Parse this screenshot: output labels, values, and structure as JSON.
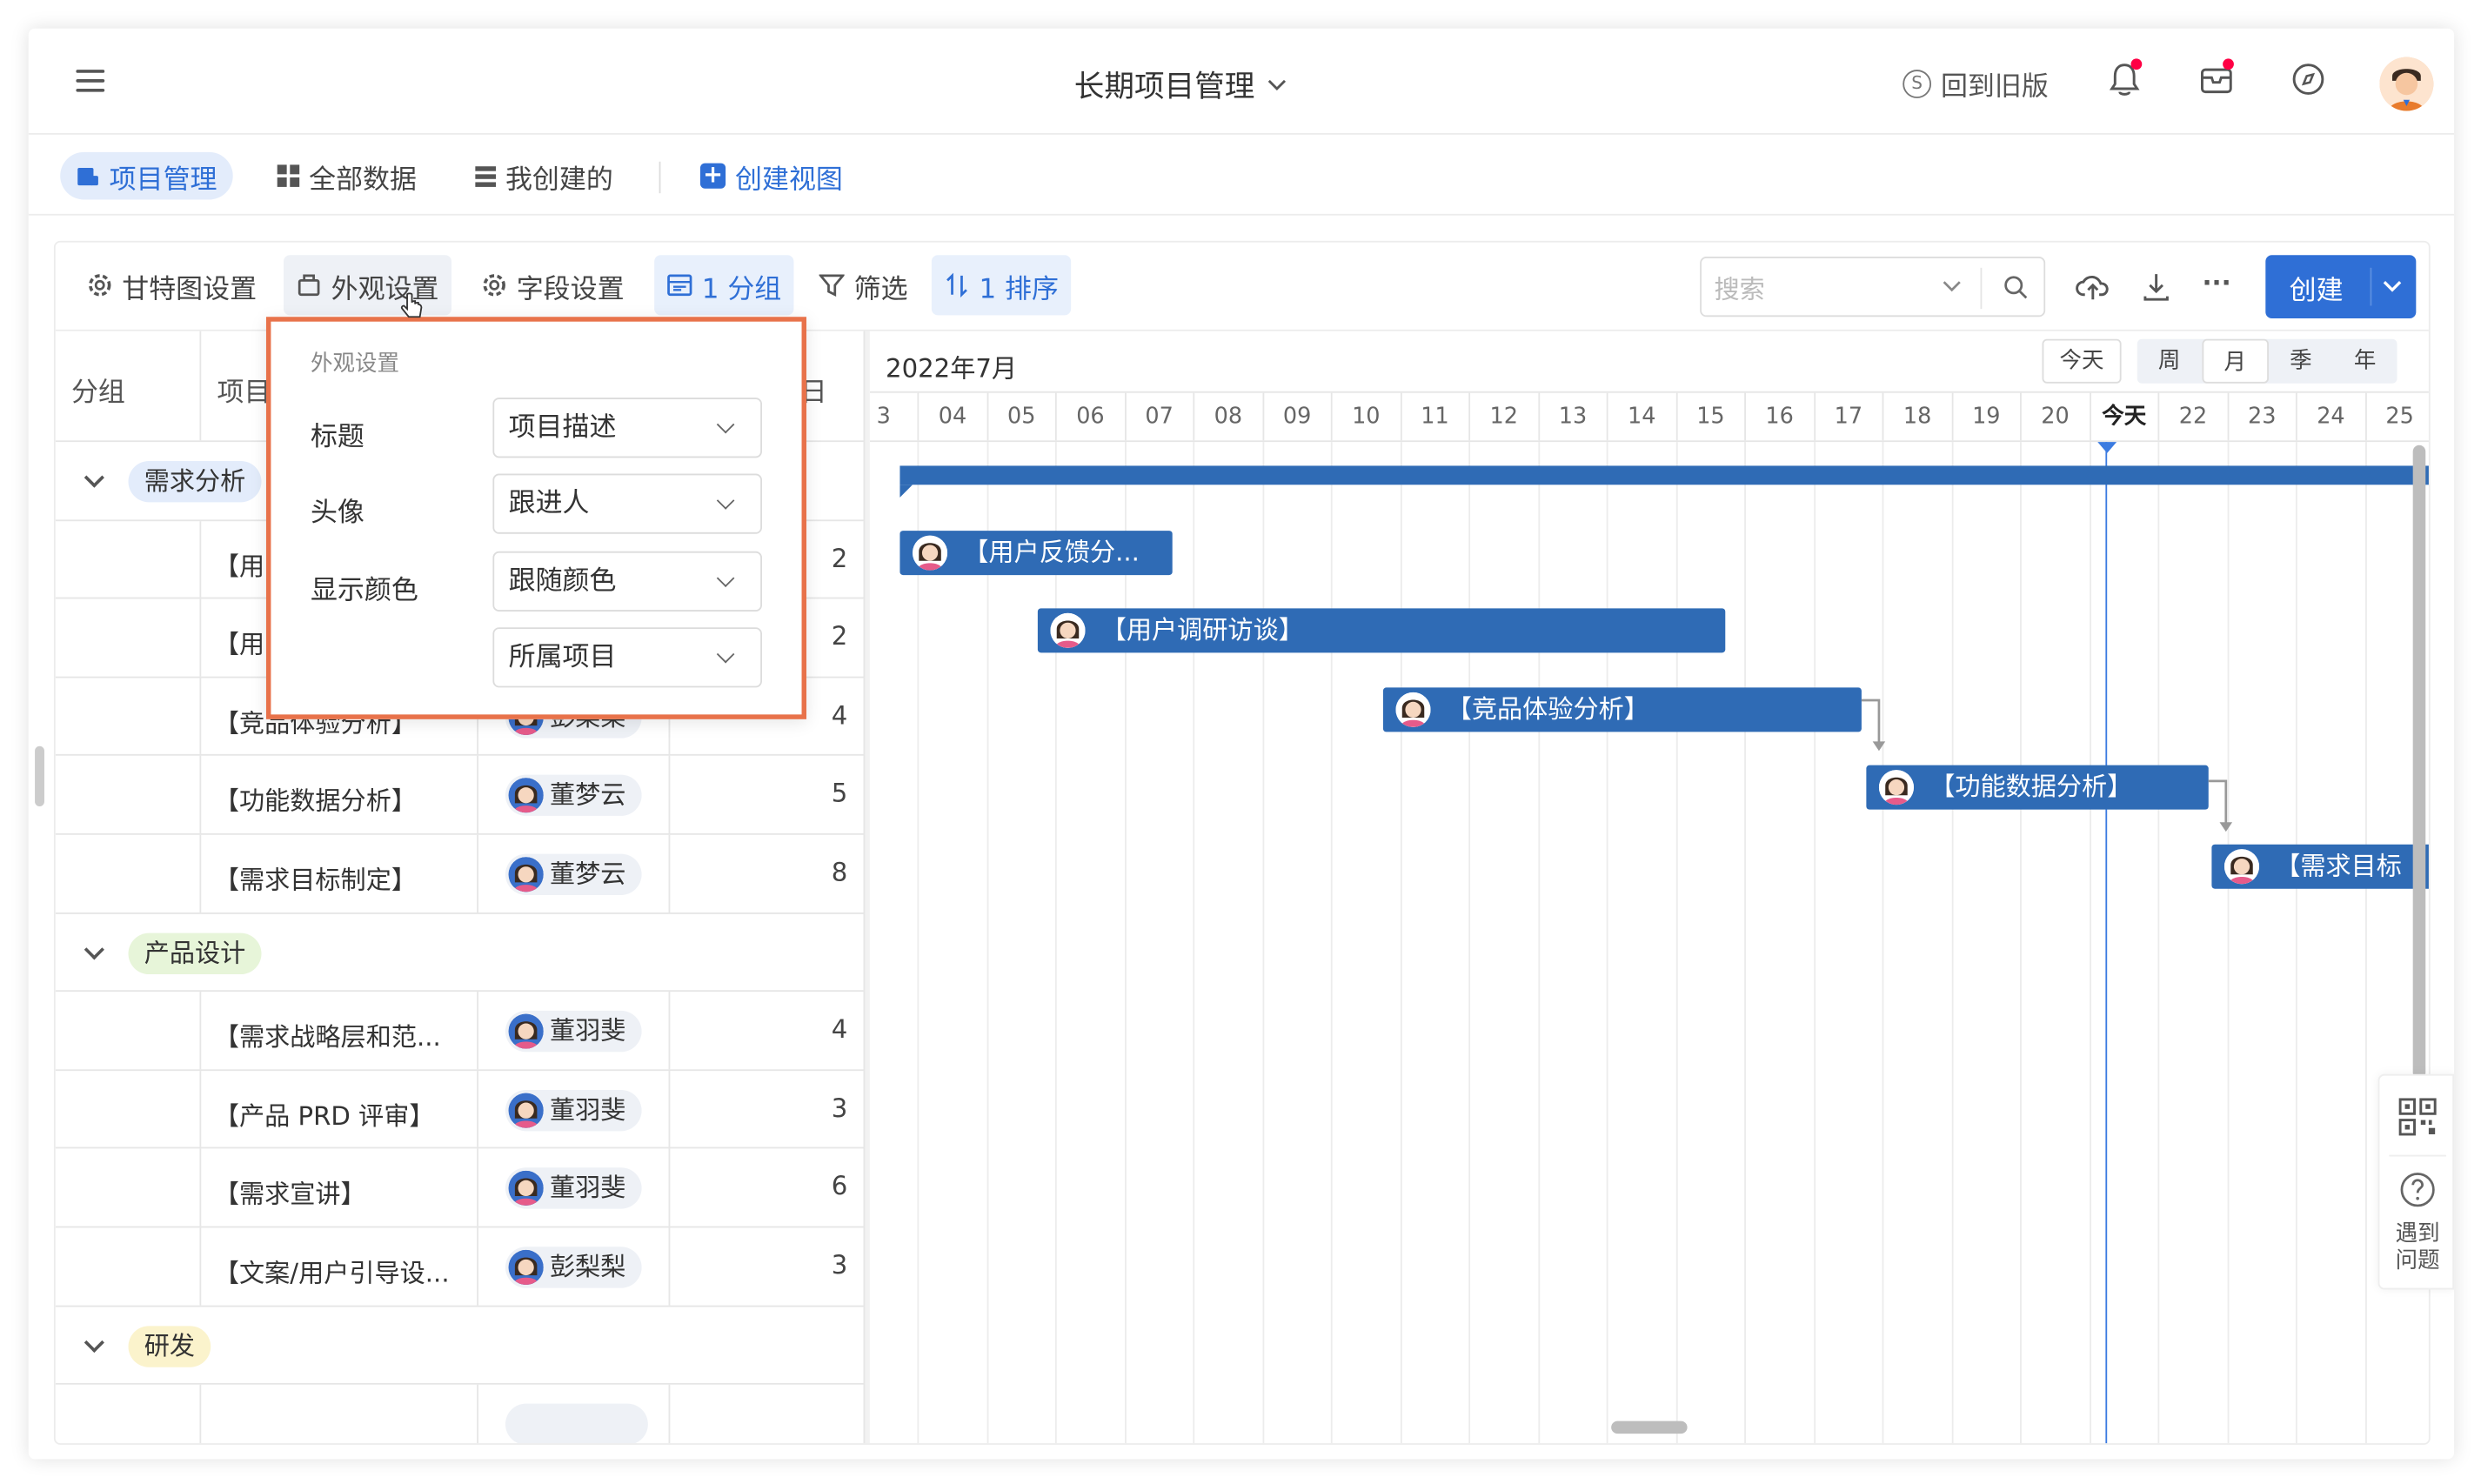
{
  "app": {
    "title": "长期项目管理",
    "back_old": "回到旧版"
  },
  "views": {
    "items": [
      "项目管理",
      "全部数据",
      "我创建的"
    ],
    "create_view": "创建视图"
  },
  "toolbar": {
    "gantt_settings": "甘特图设置",
    "appearance": "外观设置",
    "field_settings": "字段设置",
    "group": "1 分组",
    "filter": "筛选",
    "sort": "1 排序",
    "search_placeholder": "搜索",
    "more": "···",
    "create": "创建"
  },
  "table": {
    "headers": {
      "group": "分组",
      "project": "项目描",
      "days": "日"
    },
    "groups": [
      {
        "name": "需求分析",
        "rows": [
          {
            "title": "【用户反馈分...",
            "person": "",
            "days": "2"
          },
          {
            "title": "【用户调研访谈】",
            "person": "",
            "days": "2"
          },
          {
            "title": "【竞品体验分析】",
            "person": "彭梨梨",
            "days": "4"
          },
          {
            "title": "【功能数据分析】",
            "person": "董梦云",
            "days": "5"
          },
          {
            "title": "【需求目标制定】",
            "person": "董梦云",
            "days": "8"
          }
        ]
      },
      {
        "name": "产品设计",
        "rows": [
          {
            "title": "【需求战略层和范...",
            "person": "董羽斐",
            "days": "4"
          },
          {
            "title": "【产品 PRD 评审】",
            "person": "董羽斐",
            "days": "3"
          },
          {
            "title": "【需求宣讲】",
            "person": "董羽斐",
            "days": "6"
          },
          {
            "title": "【文案/用户引导设...",
            "person": "彭梨梨",
            "days": "3"
          }
        ]
      },
      {
        "name": "研发",
        "rows": []
      }
    ],
    "visible_partial": [
      "【用",
      "【用"
    ]
  },
  "gantt": {
    "month": "2022年7月",
    "today_btn": "今天",
    "scales": [
      "周",
      "月",
      "季",
      "年"
    ],
    "active_scale": "月",
    "days": [
      "3",
      "04",
      "05",
      "06",
      "07",
      "08",
      "09",
      "10",
      "11",
      "12",
      "13",
      "14",
      "15",
      "16",
      "17",
      "18",
      "19",
      "20",
      "今天",
      "22",
      "23",
      "24",
      "25"
    ],
    "bars": [
      "【用户反馈分...",
      "【用户调研访谈】",
      "【竞品体验分析】",
      "【功能数据分析】",
      "【需求目标"
    ]
  },
  "popup": {
    "title": "外观设置",
    "rows": [
      {
        "label": "标题",
        "value": "项目描述"
      },
      {
        "label": "头像",
        "value": "跟进人"
      },
      {
        "label": "显示颜色",
        "value": "跟随颜色"
      },
      {
        "label": "",
        "value": "所属项目"
      }
    ]
  },
  "sidefloat": {
    "help": "遇到问题"
  },
  "colors": {
    "accent": "#2f6fd6",
    "bar": "#2f6bb5",
    "highlight_border": "#e8724a"
  }
}
